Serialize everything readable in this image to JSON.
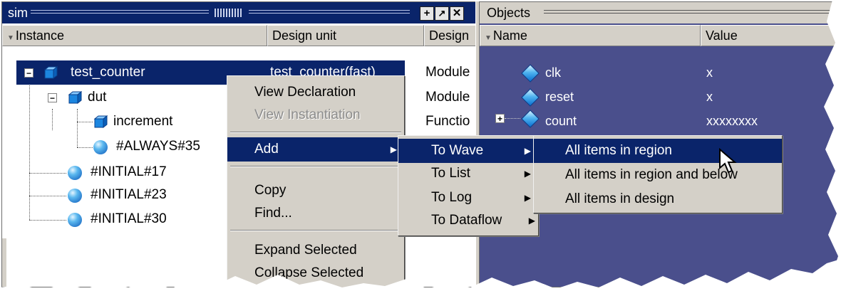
{
  "sim_pane": {
    "title": "sim",
    "columns": [
      "Instance",
      "Design unit",
      "Design"
    ],
    "rows": [
      {
        "label": "test_counter",
        "unit": "test_counter(fast)",
        "type": "Module"
      },
      {
        "label": "dut",
        "unit": "",
        "type": "Module"
      },
      {
        "label": "increment",
        "unit": "",
        "type": "Functio"
      },
      {
        "label": "#ALWAYS#35",
        "unit": "",
        "type": ""
      },
      {
        "label": "#INITIAL#17",
        "unit": "",
        "type": ""
      },
      {
        "label": "#INITIAL#23",
        "unit": "",
        "type": ""
      },
      {
        "label": "#INITIAL#30",
        "unit": "",
        "type": ""
      }
    ]
  },
  "objects_pane": {
    "title": "Objects",
    "columns": [
      "Name",
      "Value"
    ],
    "rows": [
      {
        "name": "clk",
        "value": "x"
      },
      {
        "name": "reset",
        "value": "x"
      },
      {
        "name": "count",
        "value": "xxxxxxxx"
      }
    ]
  },
  "context_menu": {
    "items": [
      "View Declaration",
      "View Instantiation",
      "Add",
      "Copy",
      "Find...",
      "Expand Selected",
      "Collapse Selected"
    ]
  },
  "add_submenu": {
    "items": [
      "To Wave",
      "To List",
      "To Log",
      "To Dataflow"
    ]
  },
  "wave_submenu": {
    "items": [
      "All items in region",
      "All items in region and below",
      "All items in design"
    ]
  },
  "colors": {
    "selection": "#0a246a",
    "menu_bg": "#d4d0c8",
    "objects_bg": "#4a4f8c"
  }
}
